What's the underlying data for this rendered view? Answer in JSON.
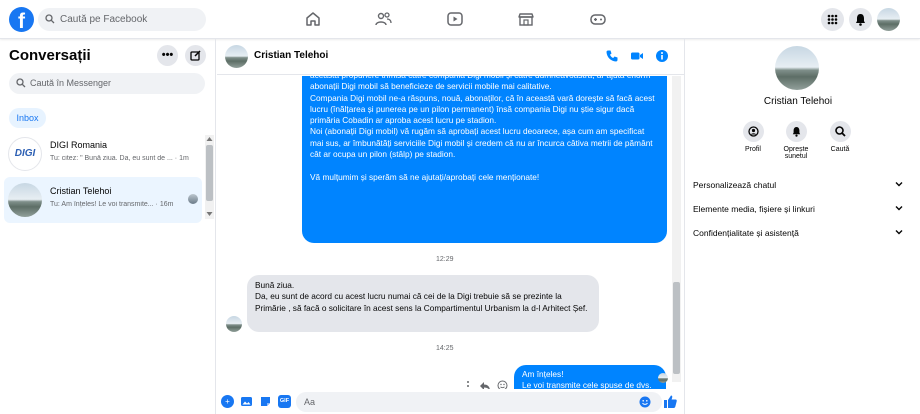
{
  "topbar": {
    "search_placeholder": "Caută pe Facebook",
    "nav_icons": [
      "home-icon",
      "friends-icon",
      "watch-icon",
      "marketplace-icon",
      "gaming-icon"
    ],
    "right_icons": [
      "menu-grid-icon",
      "notifications-icon"
    ]
  },
  "sidebar": {
    "title": "Conversații",
    "search_placeholder": "Caută în Messenger",
    "filter_label": "Inbox",
    "conversations": [
      {
        "name": "DIGI Romania",
        "snippet": "Tu: citez: \" Bună ziua. Da, eu sunt de ... · 1m",
        "avatar_text": "DIGI"
      },
      {
        "name": "Cristian Telehoi",
        "snippet": "Tu: Am înțeles! Le voi transmite... · 16m",
        "avatar_text": ""
      }
    ]
  },
  "chat": {
    "contact_name": "Cristian Telehoi",
    "messages": [
      {
        "side": "me",
        "text": "această propunere trimisă către compania Digi mobil și către dumneavoastră, ar ajuta enorm abonații Digi mobil să beneficieze de servicii mobile mai calitative.\nCompania Digi mobil ne-a răspuns, nouă, abonaților, că în această vară dorește să facă acest lucru (înălțarea și punerea pe un pilon permanent) însă compania Digi nu știe sigur dacă primăria Cobadin ar aproba acest lucru pe stadion.\nNoi (abonații Digi mobil) vă rugăm să aprobați acest lucru deoarece, așa cum am specificat mai sus, ar îmbunătăți serviciile Digi mobil și credem că nu ar încurca câtiva metrii de pământ cât ar ocupa un pilon (stâlp) pe stadion.\n\nVă mulțumim și sperăm să ne ajutați/aprobați cele menționate!"
      },
      {
        "time": "12:29"
      },
      {
        "side": "them",
        "text": "Bună ziua.\nDa, eu sunt de acord cu acest lucru numai că cei de la Digi trebuie să se prezinte la Primărie , să facă o solicitare în acest sens la Compartimentul Urbanism la d-l Arhitect Șef."
      },
      {
        "time": "14:25"
      },
      {
        "side": "me",
        "text": "Am înțeles!\nLe voi transmite cele spuse de dvs.\nVă mulțumim!"
      }
    ],
    "composer_placeholder": "Aa"
  },
  "details": {
    "name": "Cristian Telehoi",
    "actions": [
      {
        "label": "Profil",
        "icon": "profile-icon"
      },
      {
        "label": "Oprește sunetul",
        "icon": "bell-icon"
      },
      {
        "label": "Caută",
        "icon": "search-icon"
      }
    ],
    "sections": [
      "Personalizează chatul",
      "Elemente media, fișiere și linkuri",
      "Confidențialitate și asistență"
    ]
  },
  "colors": {
    "accent": "#0084ff",
    "brand": "#1877f2",
    "bubble_grey": "#e4e6eb"
  }
}
